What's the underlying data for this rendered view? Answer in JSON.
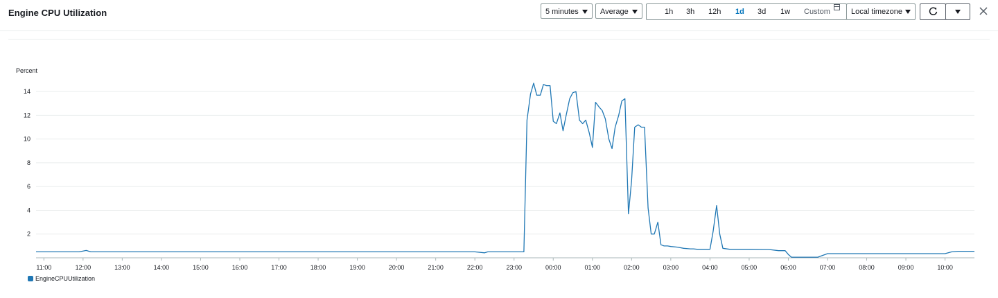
{
  "header": {
    "title": "Engine CPU Utilization",
    "period": "5 minutes",
    "statistic": "Average",
    "ranges": [
      "1h",
      "3h",
      "12h",
      "1d",
      "3d",
      "1w"
    ],
    "active_range": "1d",
    "custom_label": "Custom",
    "timezone": "Local timezone"
  },
  "colors": {
    "series": "#1f77b4",
    "active": "#0073bb",
    "grid": "#eaeded"
  },
  "chart_data": {
    "type": "line",
    "ylabel": "Percent",
    "ylim": [
      0,
      15
    ],
    "yticks": [
      2,
      4,
      6,
      8,
      10,
      12,
      14
    ],
    "xlim": [
      10.8,
      34.75
    ],
    "xticks": [
      {
        "v": 11,
        "label": "11:00"
      },
      {
        "v": 12,
        "label": "12:00"
      },
      {
        "v": 13,
        "label": "13:00"
      },
      {
        "v": 14,
        "label": "14:00"
      },
      {
        "v": 15,
        "label": "15:00"
      },
      {
        "v": 16,
        "label": "16:00"
      },
      {
        "v": 17,
        "label": "17:00"
      },
      {
        "v": 18,
        "label": "18:00"
      },
      {
        "v": 19,
        "label": "19:00"
      },
      {
        "v": 20,
        "label": "20:00"
      },
      {
        "v": 21,
        "label": "21:00"
      },
      {
        "v": 22,
        "label": "22:00"
      },
      {
        "v": 23,
        "label": "23:00"
      },
      {
        "v": 24,
        "label": "00:00"
      },
      {
        "v": 25,
        "label": "01:00"
      },
      {
        "v": 26,
        "label": "02:00"
      },
      {
        "v": 27,
        "label": "03:00"
      },
      {
        "v": 28,
        "label": "04:00"
      },
      {
        "v": 29,
        "label": "05:00"
      },
      {
        "v": 30,
        "label": "06:00"
      },
      {
        "v": 31,
        "label": "07:00"
      },
      {
        "v": 32,
        "label": "08:00"
      },
      {
        "v": 33,
        "label": "09:00"
      },
      {
        "v": 34,
        "label": "10:00"
      }
    ],
    "grid": true,
    "legend_position": "bottom-left",
    "series": [
      {
        "name": "EngineCPUUtilization",
        "x": [
          10.8,
          11.9,
          12.08,
          12.2,
          13.0,
          14.0,
          15.0,
          16.0,
          17.0,
          18.0,
          19.0,
          20.0,
          21.0,
          22.0,
          22.25,
          22.33,
          22.5,
          22.75,
          23.0,
          23.17,
          23.25,
          23.33,
          23.42,
          23.5,
          23.58,
          23.67,
          23.75,
          23.83,
          23.92,
          24.0,
          24.08,
          24.17,
          24.25,
          24.33,
          24.42,
          24.5,
          24.58,
          24.67,
          24.75,
          24.83,
          24.92,
          25.0,
          25.08,
          25.17,
          25.25,
          25.33,
          25.42,
          25.5,
          25.58,
          25.67,
          25.75,
          25.83,
          25.92,
          26.0,
          26.08,
          26.17,
          26.25,
          26.33,
          26.42,
          26.5,
          26.58,
          26.67,
          26.75,
          26.83,
          26.92,
          27.0,
          27.17,
          27.33,
          27.5,
          27.58,
          27.67,
          27.75,
          28.0,
          28.08,
          28.17,
          28.25,
          28.33,
          28.5,
          29.0,
          29.5,
          29.75,
          29.92,
          30.0,
          30.08,
          30.25,
          30.5,
          30.75,
          31.0,
          31.5,
          32.0,
          33.0,
          33.5,
          34.0,
          34.17,
          34.33,
          34.5,
          34.75
        ],
        "values": [
          0.5,
          0.5,
          0.62,
          0.5,
          0.5,
          0.5,
          0.5,
          0.5,
          0.5,
          0.5,
          0.5,
          0.5,
          0.5,
          0.5,
          0.42,
          0.5,
          0.5,
          0.5,
          0.5,
          0.5,
          0.5,
          11.6,
          13.8,
          14.7,
          13.7,
          13.7,
          14.6,
          14.5,
          14.5,
          11.5,
          11.3,
          12.2,
          10.7,
          12.0,
          13.4,
          13.9,
          14.0,
          11.6,
          11.3,
          11.6,
          10.5,
          9.3,
          13.1,
          12.7,
          12.4,
          11.7,
          10.0,
          9.2,
          11.0,
          12.0,
          13.2,
          13.4,
          3.7,
          6.5,
          11.0,
          11.2,
          11.0,
          11.0,
          4.2,
          2.0,
          2.0,
          3.0,
          1.1,
          1.0,
          1.0,
          0.95,
          0.9,
          0.8,
          0.75,
          0.75,
          0.72,
          0.72,
          0.72,
          2.2,
          4.4,
          2.0,
          0.8,
          0.72,
          0.72,
          0.7,
          0.6,
          0.6,
          0.28,
          0.05,
          0.05,
          0.05,
          0.05,
          0.35,
          0.35,
          0.35,
          0.35,
          0.35,
          0.35,
          0.5,
          0.55,
          0.55,
          0.55
        ]
      }
    ]
  }
}
